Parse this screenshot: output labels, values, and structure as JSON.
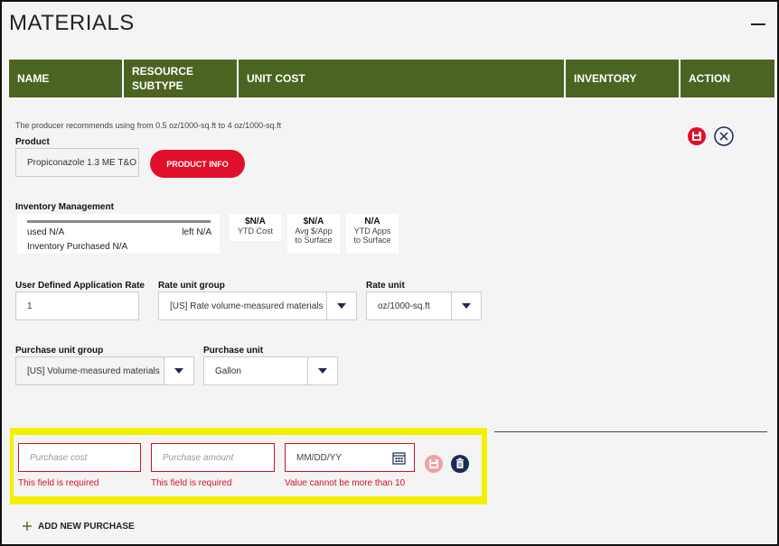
{
  "title": "MATERIALS",
  "columns": [
    "NAME",
    "RESOURCE SUBTYPE",
    "UNIT COST",
    "INVENTORY",
    "ACTION"
  ],
  "recommendation": "The producer recommends using from 0.5 oz/1000-sq.ft to 4 oz/1000-sq.ft",
  "product": {
    "label": "Product",
    "value": "Propiconazole 1.3 ME T&O",
    "info_button": "PRODUCT INFO"
  },
  "inventory": {
    "label": "Inventory Management",
    "used": "used N/A",
    "left": "left N/A",
    "purchased": "Inventory Purchased N/A",
    "stats": [
      {
        "value": "$N/A",
        "line1": "YTD Cost",
        "line2": ""
      },
      {
        "value": "$N/A",
        "line1": "Avg $/App",
        "line2": "to Surface"
      },
      {
        "value": "N/A",
        "line1": "YTD Apps",
        "line2": "to Surface"
      }
    ]
  },
  "application": {
    "rate_label": "User Defined Application Rate",
    "rate_value": "1",
    "group_label": "Rate unit group",
    "group_value": "[US] Rate volume-measured materials",
    "unit_label": "Rate unit",
    "unit_value": "oz/1000-sq.ft"
  },
  "purchase_units": {
    "group_label": "Purchase unit group",
    "group_value": "[US] Volume-measured materials",
    "unit_label": "Purchase unit",
    "unit_value": "Gallon"
  },
  "purchase_form": {
    "cost_placeholder": "Purchase cost",
    "amount_placeholder": "Purchase amount",
    "date_placeholder": "MM/DD/YY",
    "cost_error": "This field is required",
    "amount_error": "This field is required",
    "date_error": "Value cannot be more than 10"
  },
  "add_purchase": "ADD NEW PURCHASE",
  "colors": {
    "header_green": "#4c6421",
    "accent_red": "#e0102a",
    "highlight": "#f1f100",
    "navy": "#1a2a55"
  },
  "icons": [
    "save-icon",
    "cancel-circle-icon",
    "calendar-icon",
    "trash-icon",
    "plus-icon",
    "chevron-down-icon"
  ]
}
